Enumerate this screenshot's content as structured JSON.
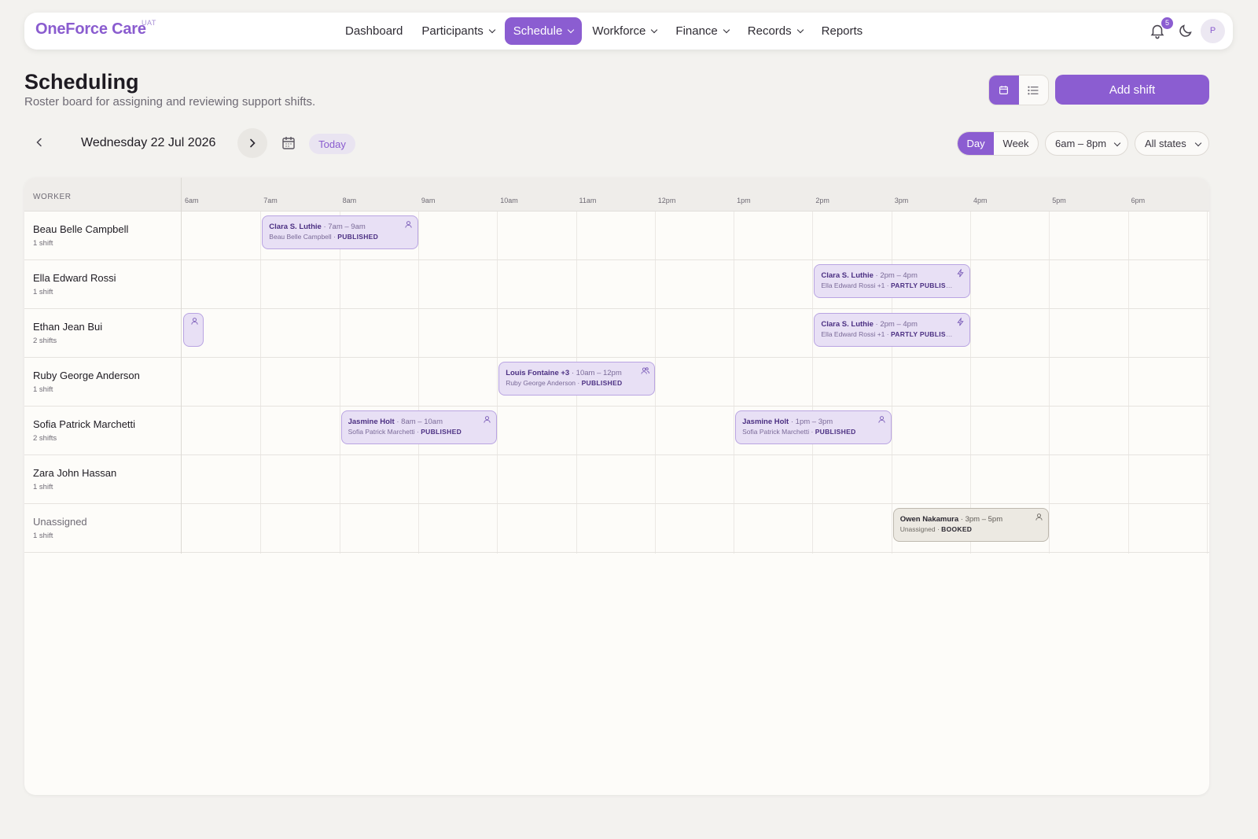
{
  "app": {
    "name": "OneForce Care",
    "env": "UAT"
  },
  "nav": [
    {
      "label": "Dashboard",
      "dropdown": false,
      "active": false
    },
    {
      "label": "Participants",
      "dropdown": true,
      "active": false
    },
    {
      "label": "Schedule",
      "dropdown": true,
      "active": true
    },
    {
      "label": "Workforce",
      "dropdown": true,
      "active": false
    },
    {
      "label": "Finance",
      "dropdown": true,
      "active": false
    },
    {
      "label": "Records",
      "dropdown": true,
      "active": false
    },
    {
      "label": "Reports",
      "dropdown": false,
      "active": false
    }
  ],
  "header_right": {
    "notification_count": "5",
    "avatar_initial": "P",
    "icons": [
      "bell-icon",
      "moon-icon"
    ]
  },
  "page": {
    "title": "Scheduling",
    "subtitle": "Roster board for assigning and reviewing support shifts."
  },
  "actions": {
    "add_shift": "Add shift",
    "view_icons": [
      "calendar-view-icon",
      "list-view-icon"
    ]
  },
  "date_bar": {
    "date": "Wednesday 22 Jul 2026",
    "today": "Today"
  },
  "filters": {
    "modes": [
      "Day",
      "Week"
    ],
    "active_mode": "Day",
    "time_range": "6am – 8pm",
    "state": "All states"
  },
  "board": {
    "worker_header": "WORKER",
    "hours": [
      "6am",
      "7am",
      "8am",
      "9am",
      "10am",
      "11am",
      "12pm",
      "1pm",
      "2pm",
      "3pm",
      "4pm",
      "5pm",
      "6pm"
    ],
    "rows": [
      {
        "name": "Beau Belle Campbell",
        "count": "1 shift",
        "unassigned": false
      },
      {
        "name": "Ella Edward Rossi",
        "count": "1 shift",
        "unassigned": false
      },
      {
        "name": "Ethan Jean Bui",
        "count": "2 shifts",
        "unassigned": false
      },
      {
        "name": "Ruby George Anderson",
        "count": "1 shift",
        "unassigned": false
      },
      {
        "name": "Sofia Patrick Marchetti",
        "count": "2 shifts",
        "unassigned": false
      },
      {
        "name": "Zara John Hassan",
        "count": "1 shift",
        "unassigned": false
      },
      {
        "name": "Unassigned",
        "count": "1 shift",
        "unassigned": true
      }
    ],
    "shifts": [
      {
        "row": 0,
        "start": 7,
        "end": 9,
        "participant": "Clara S. Luthie",
        "time": " · 7am – 9am",
        "workers": "Beau Belle Campbell · ",
        "status": "PUBLISHED",
        "icon": "person-icon",
        "booked": false,
        "compact": false
      },
      {
        "row": 1,
        "start": 14,
        "end": 16,
        "participant": "Clara S. Luthie",
        "time": " · 2pm – 4pm",
        "workers": "Ella Edward Rossi +1 · ",
        "status": "PARTLY PUBLISHED",
        "icon": "lightning-icon",
        "booked": false,
        "compact": false
      },
      {
        "row": 2,
        "start": 6,
        "end": 6.25,
        "participant": "",
        "time": "",
        "workers": "",
        "status": "",
        "icon": "person-icon",
        "booked": false,
        "compact": true
      },
      {
        "row": 2,
        "start": 14,
        "end": 16,
        "participant": "Clara S. Luthie",
        "time": " · 2pm – 4pm",
        "workers": "Ella Edward Rossi +1 · ",
        "status": "PARTLY PUBLISHED",
        "icon": "lightning-icon",
        "booked": false,
        "compact": false
      },
      {
        "row": 3,
        "start": 10,
        "end": 12,
        "participant": "Louis Fontaine +3",
        "time": " · 10am – 12pm",
        "workers": "Ruby George Anderson · ",
        "status": "PUBLISHED",
        "icon": "group-icon",
        "booked": false,
        "compact": false
      },
      {
        "row": 4,
        "start": 8,
        "end": 10,
        "participant": "Jasmine Holt",
        "time": " · 8am – 10am",
        "workers": "Sofia Patrick Marchetti · ",
        "status": "PUBLISHED",
        "icon": "person-icon",
        "booked": false,
        "compact": false
      },
      {
        "row": 4,
        "start": 13,
        "end": 15,
        "participant": "Jasmine Holt",
        "time": " · 1pm – 3pm",
        "workers": "Sofia Patrick Marchetti · ",
        "status": "PUBLISHED",
        "icon": "person-icon",
        "booked": false,
        "compact": false
      },
      {
        "row": 6,
        "start": 15,
        "end": 17,
        "participant": "Owen Nakamura",
        "time": " · 3pm – 5pm",
        "workers": "Unassigned · ",
        "status": "BOOKED",
        "icon": "person-icon",
        "booked": true,
        "compact": false
      }
    ]
  },
  "colors": {
    "accent": "#8b5dd1",
    "shift_bg": "#e8e0f5",
    "booked_bg": "#ece9e2",
    "page_bg": "#f3f2ef"
  }
}
